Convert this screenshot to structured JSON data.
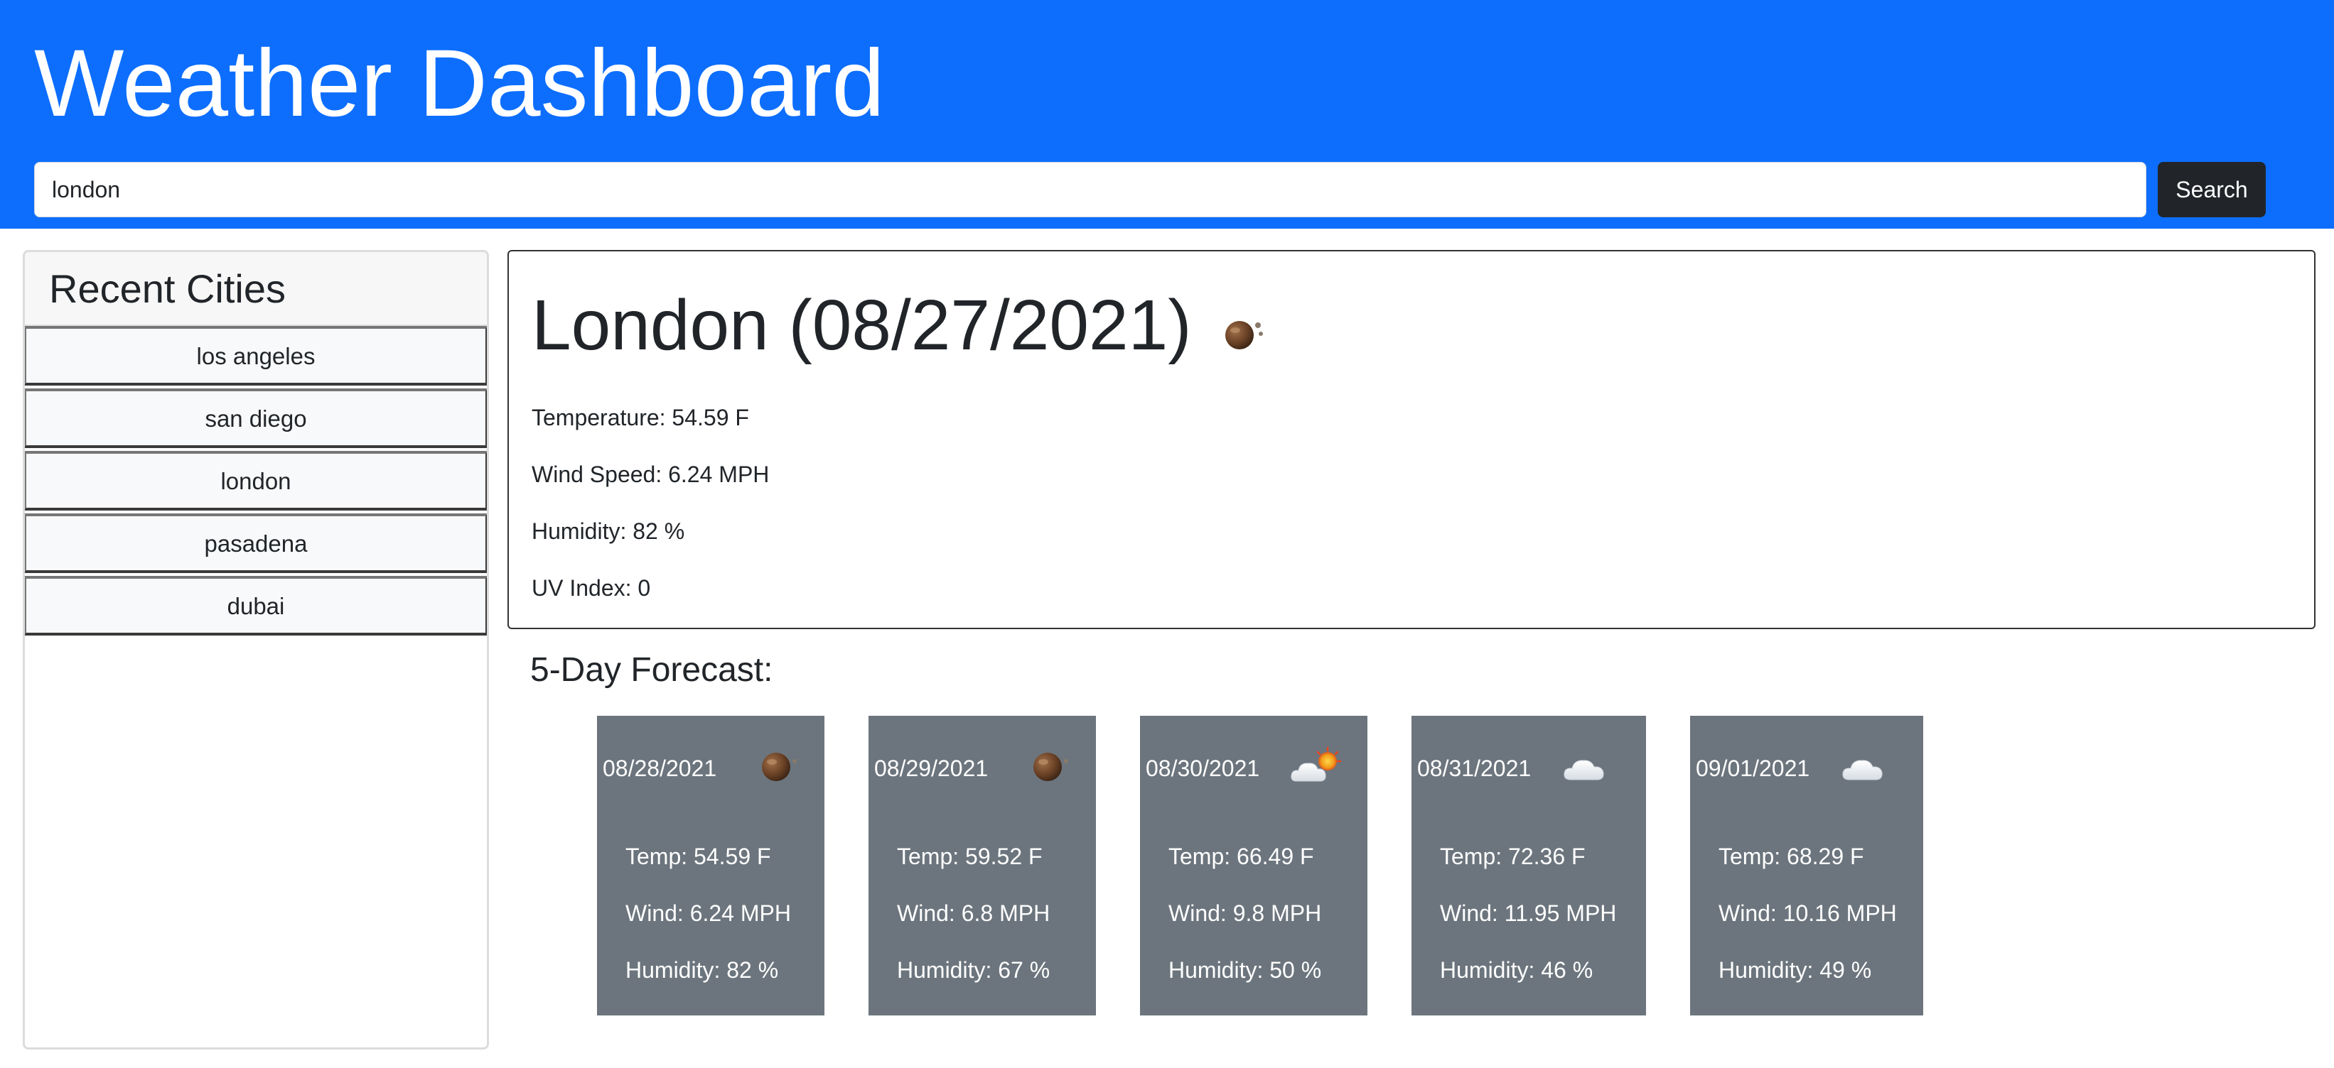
{
  "app": {
    "title": "Weather Dashboard"
  },
  "search": {
    "value": "london",
    "placeholder": "",
    "button_label": "Search"
  },
  "sidebar": {
    "title": "Recent Cities",
    "cities": [
      "los angeles",
      "san diego",
      "london",
      "pasadena",
      "dubai"
    ]
  },
  "current": {
    "heading": "London (08/27/2021)",
    "icon": "mist-icon",
    "temperature": "Temperature: 54.59 F",
    "wind": "Wind Speed: 6.24 MPH",
    "humidity": "Humidity: 82 %",
    "uv": "UV Index: 0"
  },
  "forecast": {
    "title": "5-Day Forecast:",
    "days": [
      {
        "date": "08/28/2021",
        "icon": "mist-icon",
        "temp": "Temp: 54.59 F",
        "wind": "Wind: 6.24 MPH",
        "humidity": "Humidity: 82 %"
      },
      {
        "date": "08/29/2021",
        "icon": "mist-icon",
        "temp": "Temp: 59.52 F",
        "wind": "Wind: 6.8 MPH",
        "humidity": "Humidity: 67 %"
      },
      {
        "date": "08/30/2021",
        "icon": "partly-cloudy-icon",
        "temp": "Temp: 66.49 F",
        "wind": "Wind: 9.8 MPH",
        "humidity": "Humidity: 50 %"
      },
      {
        "date": "08/31/2021",
        "icon": "cloud-icon",
        "temp": "Temp: 72.36 F",
        "wind": "Wind: 11.95 MPH",
        "humidity": "Humidity: 46 %"
      },
      {
        "date": "09/01/2021",
        "icon": "cloud-icon",
        "temp": "Temp: 68.29 F",
        "wind": "Wind: 10.16 MPH",
        "humidity": "Humidity: 49 %"
      }
    ]
  },
  "colors": {
    "header_bg": "#0d6efd",
    "card_bg": "#6c757d",
    "button_dark": "#212529"
  }
}
